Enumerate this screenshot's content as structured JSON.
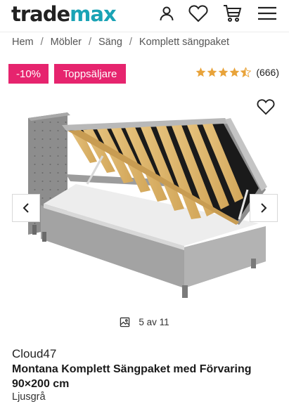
{
  "header": {
    "logo_part1": "trade",
    "logo_part2": "max",
    "icons": [
      "account-icon",
      "heart-icon",
      "cart-icon",
      "menu-icon"
    ]
  },
  "breadcrumb": [
    "Hem",
    "Möbler",
    "Säng",
    "Komplett sängpaket"
  ],
  "badges": {
    "discount": "-10%",
    "label": "Toppsäljare"
  },
  "rating": {
    "stars": 4.5,
    "count": "(666)"
  },
  "gallery": {
    "counter": "5 av 11"
  },
  "product": {
    "brand": "Cloud47",
    "title": "Montana Komplett Sängpaket med Förvaring 90×200 cm",
    "color": "Ljusgrå"
  },
  "colors": {
    "accent": "#e6246e",
    "brand_teal": "#1aa3b5",
    "star": "#e8a33a"
  }
}
